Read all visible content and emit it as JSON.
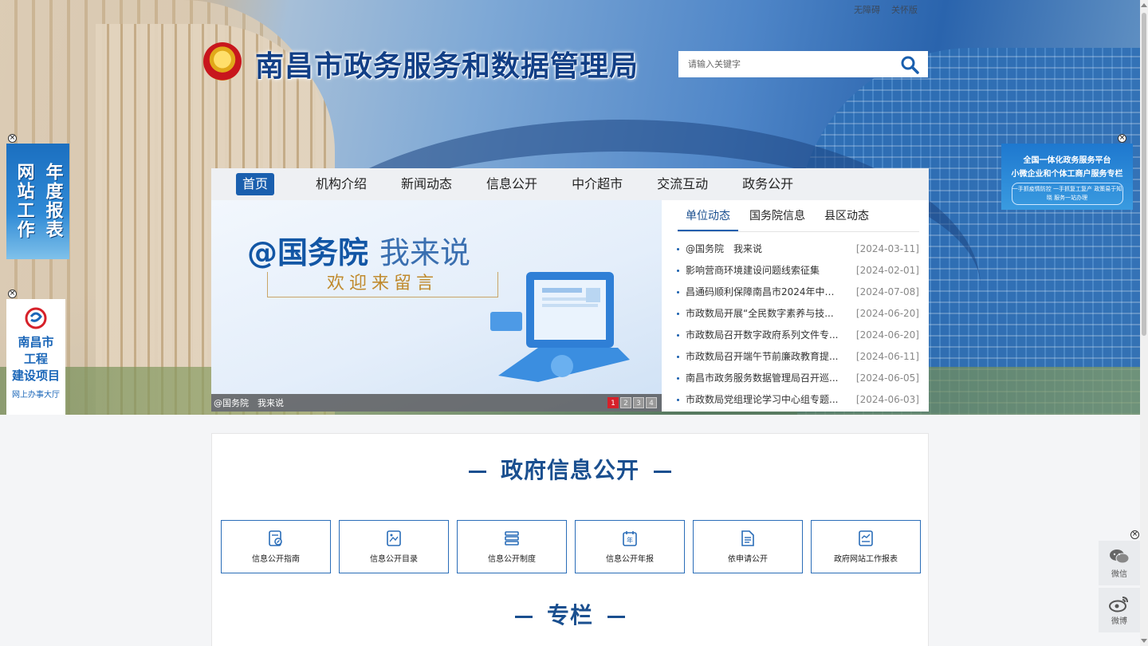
{
  "top_links": {
    "accessible": "无障碍",
    "care": "关怀版"
  },
  "site": {
    "title": "南昌市政务服务和数据管理局"
  },
  "search": {
    "placeholder": "请输入关键字",
    "icon": "search-icon"
  },
  "ads": {
    "annual_report": {
      "col1": "网站工作",
      "col2": "年度报表"
    },
    "project": {
      "line1": "南昌市",
      "line2": "工程",
      "line3": "建设项目",
      "line4": "网上办事大厅"
    },
    "right_banner": {
      "line1": "全国一体化政务服务平台",
      "line2": "小微企业和个体工商户服务专栏",
      "line3": "一手抓疫情防控 一手抓复工复产 政策易于知晓 服务一站办理"
    }
  },
  "nav": {
    "items": [
      {
        "label": "首页",
        "active": true
      },
      {
        "label": "机构介绍"
      },
      {
        "label": "新闻动态"
      },
      {
        "label": "信息公开"
      },
      {
        "label": "中介超市"
      },
      {
        "label": "交流互动"
      },
      {
        "label": "政务公开"
      }
    ]
  },
  "banner": {
    "title_main": "@国务院",
    "title_light": "我来说",
    "subtitle": "欢迎来留言",
    "caption": "@国务院　我来说",
    "pages": [
      "1",
      "2",
      "3",
      "4"
    ],
    "active_page": 1
  },
  "news": {
    "tabs": [
      "单位动态",
      "国务院信息",
      "县区动态"
    ],
    "items": [
      {
        "title": "@国务院　我来说",
        "date": "[2024-03-11]"
      },
      {
        "title": "影响营商环境建设问题线索征集",
        "date": "[2024-02-01]"
      },
      {
        "title": "昌通码顺利保障南昌市2024年中考...",
        "date": "[2024-07-08]"
      },
      {
        "title": "市政数局开展“全民数字素养与技...",
        "date": "[2024-06-20]"
      },
      {
        "title": "市政数局召开数字政府系列文件专...",
        "date": "[2024-06-20]"
      },
      {
        "title": "市政数局召开端午节前廉政教育提...",
        "date": "[2024-06-11]"
      },
      {
        "title": "南昌市政务服务数据管理局召开巡...",
        "date": "[2024-06-05]"
      },
      {
        "title": "市政数局党组理论学习中心组专题...",
        "date": "[2024-06-03]"
      }
    ]
  },
  "sections": {
    "gov_info": {
      "title": "政府信息公开"
    },
    "special": {
      "title": "专栏"
    }
  },
  "cards": [
    {
      "label": "信息公开指南",
      "icon": "guide-icon"
    },
    {
      "label": "信息公开目录",
      "icon": "catalog-icon"
    },
    {
      "label": "信息公开制度",
      "icon": "system-icon"
    },
    {
      "label": "信息公开年报",
      "icon": "annual-report-icon"
    },
    {
      "label": "依申请公开",
      "icon": "application-icon"
    },
    {
      "label": "政府网站工作报表",
      "icon": "report-icon"
    }
  ],
  "social": {
    "wechat": "微信",
    "weibo": "微博"
  },
  "colors": {
    "primary": "#1a5fae",
    "title": "#1a4f8f",
    "pager_active": "#d6212a"
  }
}
